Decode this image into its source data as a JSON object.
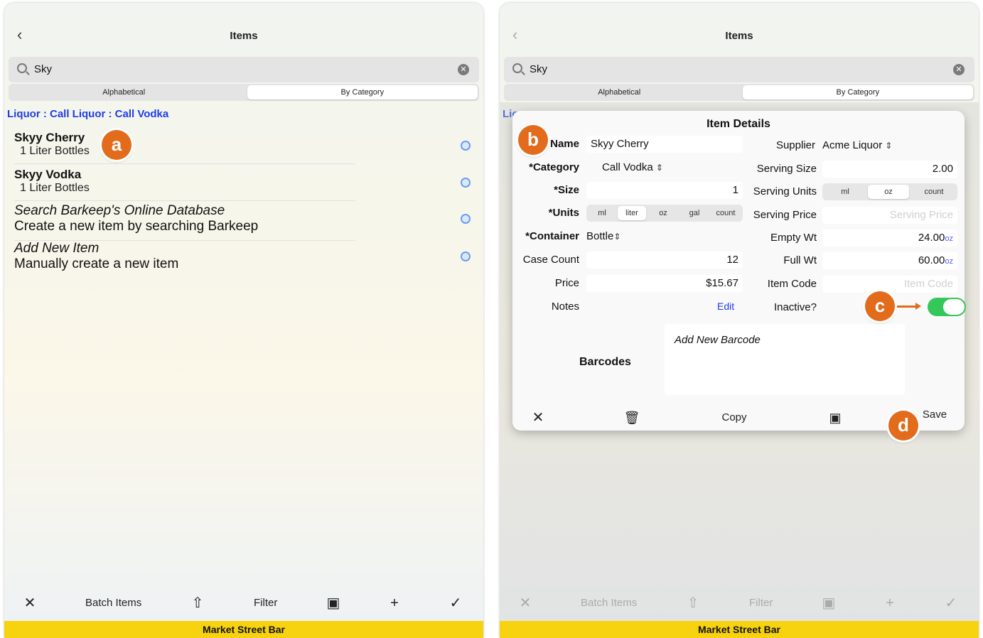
{
  "left": {
    "nav_title": "Items",
    "search": {
      "value": "Sky"
    },
    "segments": {
      "alphabetical": "Alphabetical",
      "by_category": "By Category"
    },
    "breadcrumb": "Liquor : Call Liquor : Call Vodka",
    "items": [
      {
        "title": "Skyy Cherry",
        "sub": "1 Liter Bottles"
      },
      {
        "title": "Skyy Vodka",
        "sub": "1 Liter Bottles"
      }
    ],
    "actions": [
      {
        "title": "Search Barkeep's Online Database",
        "desc": "Create a new item by searching Barkeep"
      },
      {
        "title": "Add New Item",
        "desc": "Manually create a new item"
      }
    ],
    "toolbar": {
      "batch": "Batch Items",
      "filter": "Filter"
    },
    "footer": "Market Street Bar",
    "badge": "a"
  },
  "right": {
    "nav_title": "Items",
    "search": {
      "value": "Sky"
    },
    "segments": {
      "alphabetical": "Alphabetical",
      "by_category": "By Category"
    },
    "breadcrumb_partial": "Lio",
    "modal": {
      "title": "Item Details",
      "labels": {
        "name": "*Name",
        "category": "*Category",
        "size": "*Size",
        "units": "*Units",
        "container": "*Container",
        "case_count": "Case Count",
        "price": "Price",
        "notes": "Notes",
        "supplier": "Supplier",
        "serving_size": "Serving Size",
        "serving_units": "Serving Units",
        "serving_price": "Serving Price",
        "empty_wt": "Empty Wt",
        "full_wt": "Full Wt",
        "item_code": "Item Code",
        "inactive": "Inactive?",
        "barcodes": "Barcodes"
      },
      "values": {
        "name": "Skyy Cherry",
        "category": "Call Vodka",
        "size": "1",
        "container": "Bottle",
        "case_count": "12",
        "price": "$15.67",
        "notes_edit": "Edit",
        "supplier": "Acme Liquor",
        "serving_size": "2.00",
        "empty_wt": "24.00",
        "full_wt": "60.00",
        "wt_unit": "oz",
        "inactive": true
      },
      "placeholders": {
        "serving_price": "Serving Price",
        "item_code": "Item Code"
      },
      "units_options": [
        "ml",
        "liter",
        "oz",
        "gal",
        "count"
      ],
      "units_selected": "liter",
      "serving_units_options": [
        "ml",
        "oz",
        "count"
      ],
      "serving_units_selected": "oz",
      "add_barcode": "Add New Barcode",
      "buttons": {
        "copy": "Copy",
        "save": "Save"
      }
    },
    "toolbar": {
      "batch": "Batch Items",
      "filter": "Filter"
    },
    "footer": "Market Street Bar",
    "badges": {
      "b": "b",
      "c": "c",
      "d": "d"
    }
  },
  "colors": {
    "accent": "#1e3ee8",
    "badge": "#e26b1c",
    "footer": "#f7d20f",
    "toggle_on": "#34c759"
  }
}
